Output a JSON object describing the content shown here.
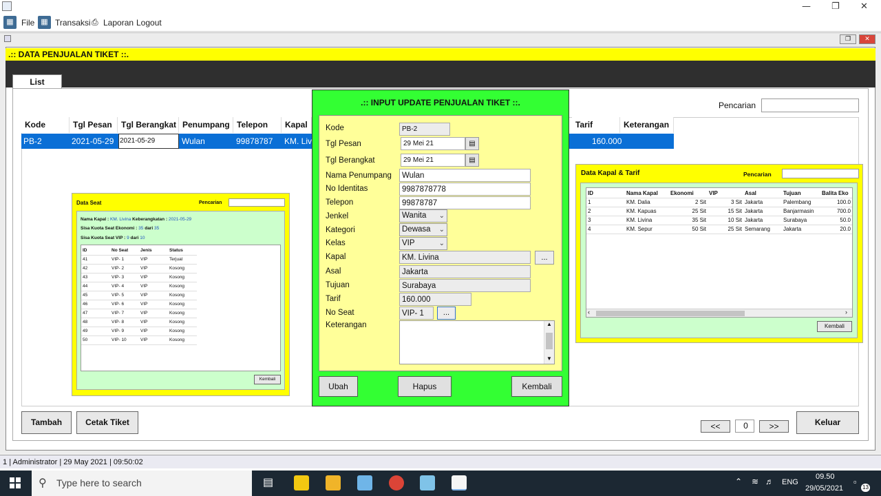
{
  "menu": {
    "file": "File",
    "transaksi": "Transaksi",
    "laporan": "Laporan",
    "logout": "Logout"
  },
  "frame": {
    "title": ".:: DATA PENJUALAN TIKET ::.",
    "tab_list": "List"
  },
  "search_label": "Pencarian",
  "main_table": {
    "headers": [
      "Kode",
      "Tgl Pesan",
      "Tgl Berangkat",
      "Penumpang",
      "Telepon",
      "Kapal",
      "Tarif",
      "Keterangan"
    ],
    "row": {
      "kode": "PB-2",
      "tgl_pesan": "2021-05-29",
      "tgl_berangkat": "2021-05-29",
      "penumpang": "Wulan",
      "telepon": "99878787",
      "kapal": "KM. Livi",
      "tarif": "160.000"
    }
  },
  "buttons": {
    "tambah": "Tambah",
    "cetak": "Cetak Tiket",
    "keluar": "Keluar",
    "prev": "<<",
    "page": "0",
    "next": ">>"
  },
  "data_seat": {
    "title": "Data Seat",
    "search_label": "Pencarian",
    "nama_kapal_label": "Nama Kapal :",
    "nama_kapal": "KM. Livina",
    "keberangkatan_label": "Keberangkatan :",
    "keberangkatan": "2021-05-29",
    "ekonomi_label": "Sisa Kuota Seat Ekonomi :",
    "ekonomi_sisa": "35",
    "dari": "dari",
    "ekonomi_total": "35",
    "vip_label": "Sisa Kuota Seat VIP :",
    "vip_sisa": "9",
    "vip_total": "10",
    "headers": [
      "ID",
      "No Seat",
      "Jenis",
      "Status"
    ],
    "rows": [
      [
        "41",
        "VIP- 1",
        "VIP",
        "Terjual"
      ],
      [
        "42",
        "VIP- 2",
        "VIP",
        "Kosong"
      ],
      [
        "43",
        "VIP- 3",
        "VIP",
        "Kosong"
      ],
      [
        "44",
        "VIP- 4",
        "VIP",
        "Kosong"
      ],
      [
        "45",
        "VIP- 5",
        "VIP",
        "Kosong"
      ],
      [
        "46",
        "VIP- 6",
        "VIP",
        "Kosong"
      ],
      [
        "47",
        "VIP- 7",
        "VIP",
        "Kosong"
      ],
      [
        "48",
        "VIP- 8",
        "VIP",
        "Kosong"
      ],
      [
        "49",
        "VIP- 9",
        "VIP",
        "Kosong"
      ],
      [
        "50",
        "VIP- 10",
        "VIP",
        "Kosong"
      ]
    ],
    "kembali": "Kembali"
  },
  "data_kapal": {
    "title": "Data Kapal & Tarif",
    "search_label": "Pencarian",
    "headers": [
      "ID",
      "Nama Kapal",
      "Ekonomi",
      "VIP",
      "Asal",
      "Tujuan",
      "Balita Eko"
    ],
    "rows": [
      [
        "1",
        "KM. Dalia",
        "2 Sit",
        "3 Sit",
        "Jakarta",
        "Palembang",
        "100.0"
      ],
      [
        "2",
        "KM. Kapuas",
        "25 Sit",
        "15 Sit",
        "Jakarta",
        "Banjarmasin",
        "700.0"
      ],
      [
        "3",
        "KM. Livina",
        "35 Sit",
        "10 Sit",
        "Jakarta",
        "Surabaya",
        "50.0"
      ],
      [
        "4",
        "KM. Sepur",
        "50 Sit",
        "25 Sit",
        "Semarang",
        "Jakarta",
        "20.0"
      ]
    ],
    "kembali": "Kembali"
  },
  "dialog": {
    "title": ".:: INPUT UPDATE PENJUALAN TIKET ::.",
    "labels": {
      "kode": "Kode",
      "tgl_pesan": "Tgl Pesan",
      "tgl_berangkat": "Tgl Berangkat",
      "nama": "Nama Penumpang",
      "no_id": "No Identitas",
      "telepon": "Telepon",
      "jenkel": "Jenkel",
      "kategori": "Kategori",
      "kelas": "Kelas",
      "kapal": "Kapal",
      "asal": "Asal",
      "tujuan": "Tujuan",
      "tarif": "Tarif",
      "no_seat": "No Seat",
      "keterangan": "Keterangan"
    },
    "values": {
      "kode": "PB-2",
      "tgl_pesan": "29 Mei 21",
      "tgl_berangkat": "29 Mei 21",
      "nama": "Wulan",
      "no_id": "9987878778",
      "telepon": "99878787",
      "jenkel": "Wanita",
      "kategori": "Dewasa",
      "kelas": "VIP",
      "kapal": "KM. Livina",
      "asal": "Jakarta",
      "tujuan": "Surabaya",
      "tarif": "160.000",
      "no_seat": "VIP- 1"
    },
    "ellipsis": "...",
    "buttons": {
      "ubah": "Ubah",
      "hapus": "Hapus",
      "kembali": "Kembali"
    }
  },
  "status": {
    "id": "1",
    "user": "Administrator",
    "date": "29 May 2021",
    "time": "09:50:02"
  },
  "taskbar": {
    "search_placeholder": "Type here to search",
    "lang": "ENG",
    "clock_time": "09.50",
    "clock_date": "29/05/2021",
    "notif": "13"
  }
}
